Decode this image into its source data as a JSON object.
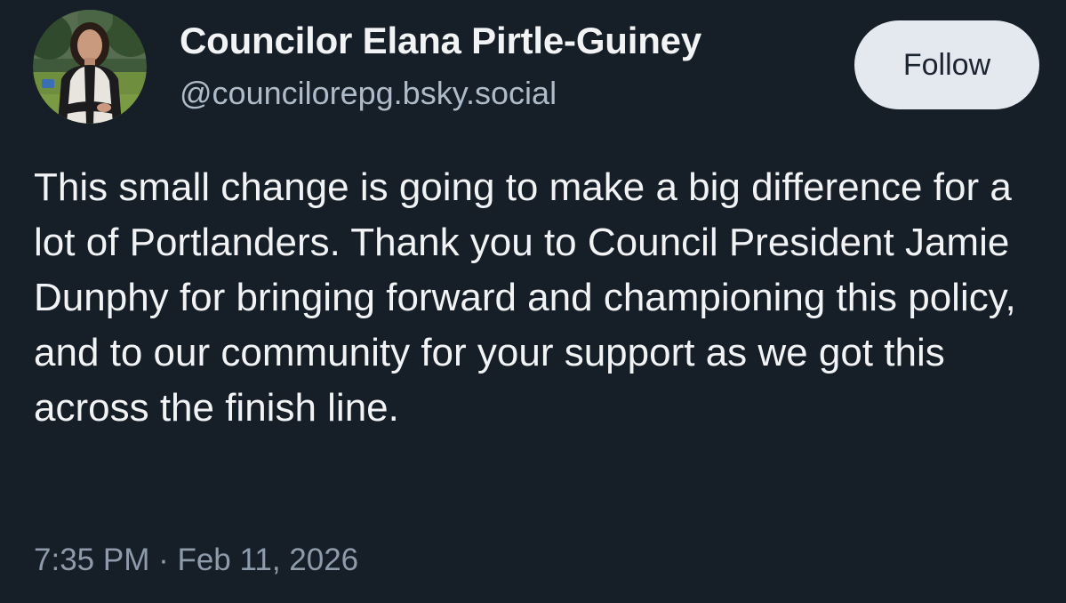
{
  "author": {
    "display_name": "Councilor Elana Pirtle-Guiney",
    "handle": "@councilorepg.bsky.social",
    "avatar_description": "profile-photo"
  },
  "actions": {
    "follow_label": "Follow"
  },
  "post": {
    "text": "This small change is going to make a big difference for a lot of Portlanders. Thank you to Council President Jamie Dunphy for bringing forward and championing this policy, and to our community for your support as we got this across the finish line.",
    "timestamp": "7:35 PM · Feb 11, 2026"
  },
  "colors": {
    "background": "#161e27",
    "text_primary": "#f1f3f5",
    "text_secondary": "#aebbc9",
    "timestamp": "#8e9bab",
    "follow_button_bg": "#e4e8ef",
    "follow_button_text": "#1b2430"
  }
}
